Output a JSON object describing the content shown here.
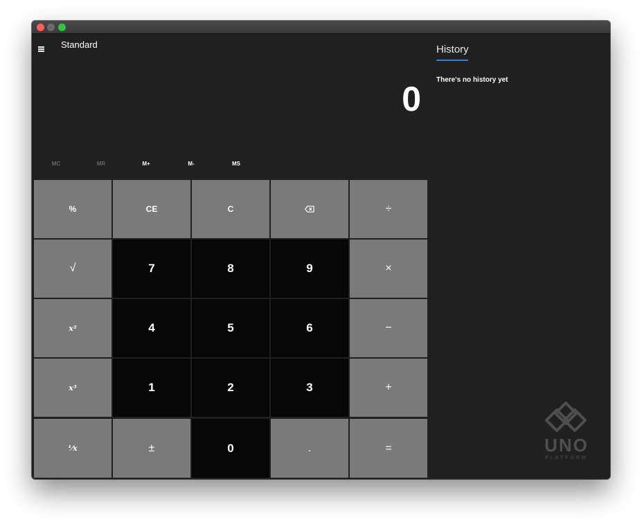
{
  "app": {
    "mode_title": "Standard"
  },
  "display": {
    "value": "0"
  },
  "memory": [
    {
      "label": "MC",
      "enabled": false
    },
    {
      "label": "MR",
      "enabled": false
    },
    {
      "label": "M+",
      "enabled": true
    },
    {
      "label": "M-",
      "enabled": true
    },
    {
      "label": "MS",
      "enabled": true
    }
  ],
  "keys": {
    "percent": "%",
    "clear_entry": "CE",
    "clear": "C",
    "divide": "÷",
    "sqrt": "√",
    "multiply": "×",
    "square": "x²",
    "minus": "−",
    "cube": "x³",
    "plus": "+",
    "reciprocal": "⅟x",
    "negate": "±",
    "decimal": ".",
    "equals": "=",
    "d7": "7",
    "d8": "8",
    "d9": "9",
    "d4": "4",
    "d5": "5",
    "d6": "6",
    "d1": "1",
    "d2": "2",
    "d3": "3",
    "d0": "0"
  },
  "history": {
    "title": "History",
    "empty_message": "There's no history yet"
  },
  "logo": {
    "word": "UNO",
    "tagline": "PLATFORM"
  },
  "colors": {
    "window_bg": "#202020",
    "operator_key": "#7a7a7a",
    "digit_key": "#060606",
    "accent": "#3a7bd5"
  }
}
